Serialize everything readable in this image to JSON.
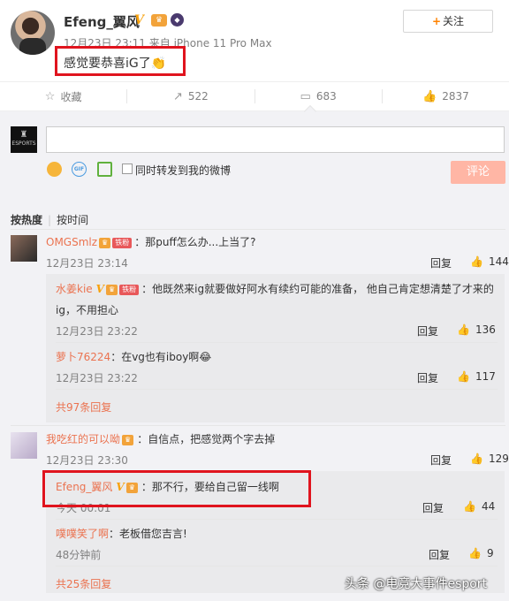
{
  "post": {
    "username": "Efeng_翼风",
    "v_mark": "V",
    "meta": "12月23日 23:11 来自 iPhone 11 Pro Max",
    "content": "感觉要恭喜iG了👏",
    "follow_plus": "+",
    "follow_label": "关注"
  },
  "actions": {
    "favorite_label": "收藏",
    "repost_count": "522",
    "comment_count": "683",
    "like_count": "2837"
  },
  "composer": {
    "input_value": "",
    "gif_label": "GIF",
    "repost_label": "同时转发到我的微博",
    "submit_label": "评论",
    "avatar_text": "ESPORTS"
  },
  "sort": {
    "hot": "按热度",
    "time": "按时间"
  },
  "comments": [
    {
      "name": "OMGSmlz",
      "badge": "铁粉",
      "text": "：那puff怎么办...上当了?",
      "time": "12月23日 23:14",
      "reply": "回复",
      "likes": "144",
      "replies": [
        {
          "name": "水姜kie",
          "badge": "铁粉",
          "text": "：他既然来ig就要做好阿水有续约可能的准备，  他自己肯定想清楚了才来的",
          "text2": "ig，不用担心",
          "time": "12月23日 23:22",
          "reply": "回复",
          "likes": "136"
        },
        {
          "name": "萝卜76224",
          "text": "：在vg也有iboy啊😂",
          "time": "12月23日 23:22",
          "reply": "回复",
          "likes": "117"
        }
      ],
      "more": "共97条回复"
    },
    {
      "name": "我吃红的可以呦",
      "text": "：自信点，把感觉两个字去掉",
      "time": "12月23日 23:30",
      "reply": "回复",
      "likes": "129",
      "replies": [
        {
          "name": "Efeng_翼风",
          "text": "：那不行，要给自己留一线啊",
          "time": "今天 00:01",
          "reply": "回复",
          "likes": "44"
        },
        {
          "name": "噗噗笑了啊",
          "text": "：老板借您吉言!",
          "time": "48分钟前",
          "reply": "回复",
          "likes": "9"
        }
      ],
      "more": "共25条回复"
    }
  ],
  "watermark": "头条 @电竞大事件esport",
  "colors": {
    "accent": "#eb7350",
    "highlight": "#e0141e",
    "submit": "#ffb6a5",
    "v": "#f7a10c"
  }
}
